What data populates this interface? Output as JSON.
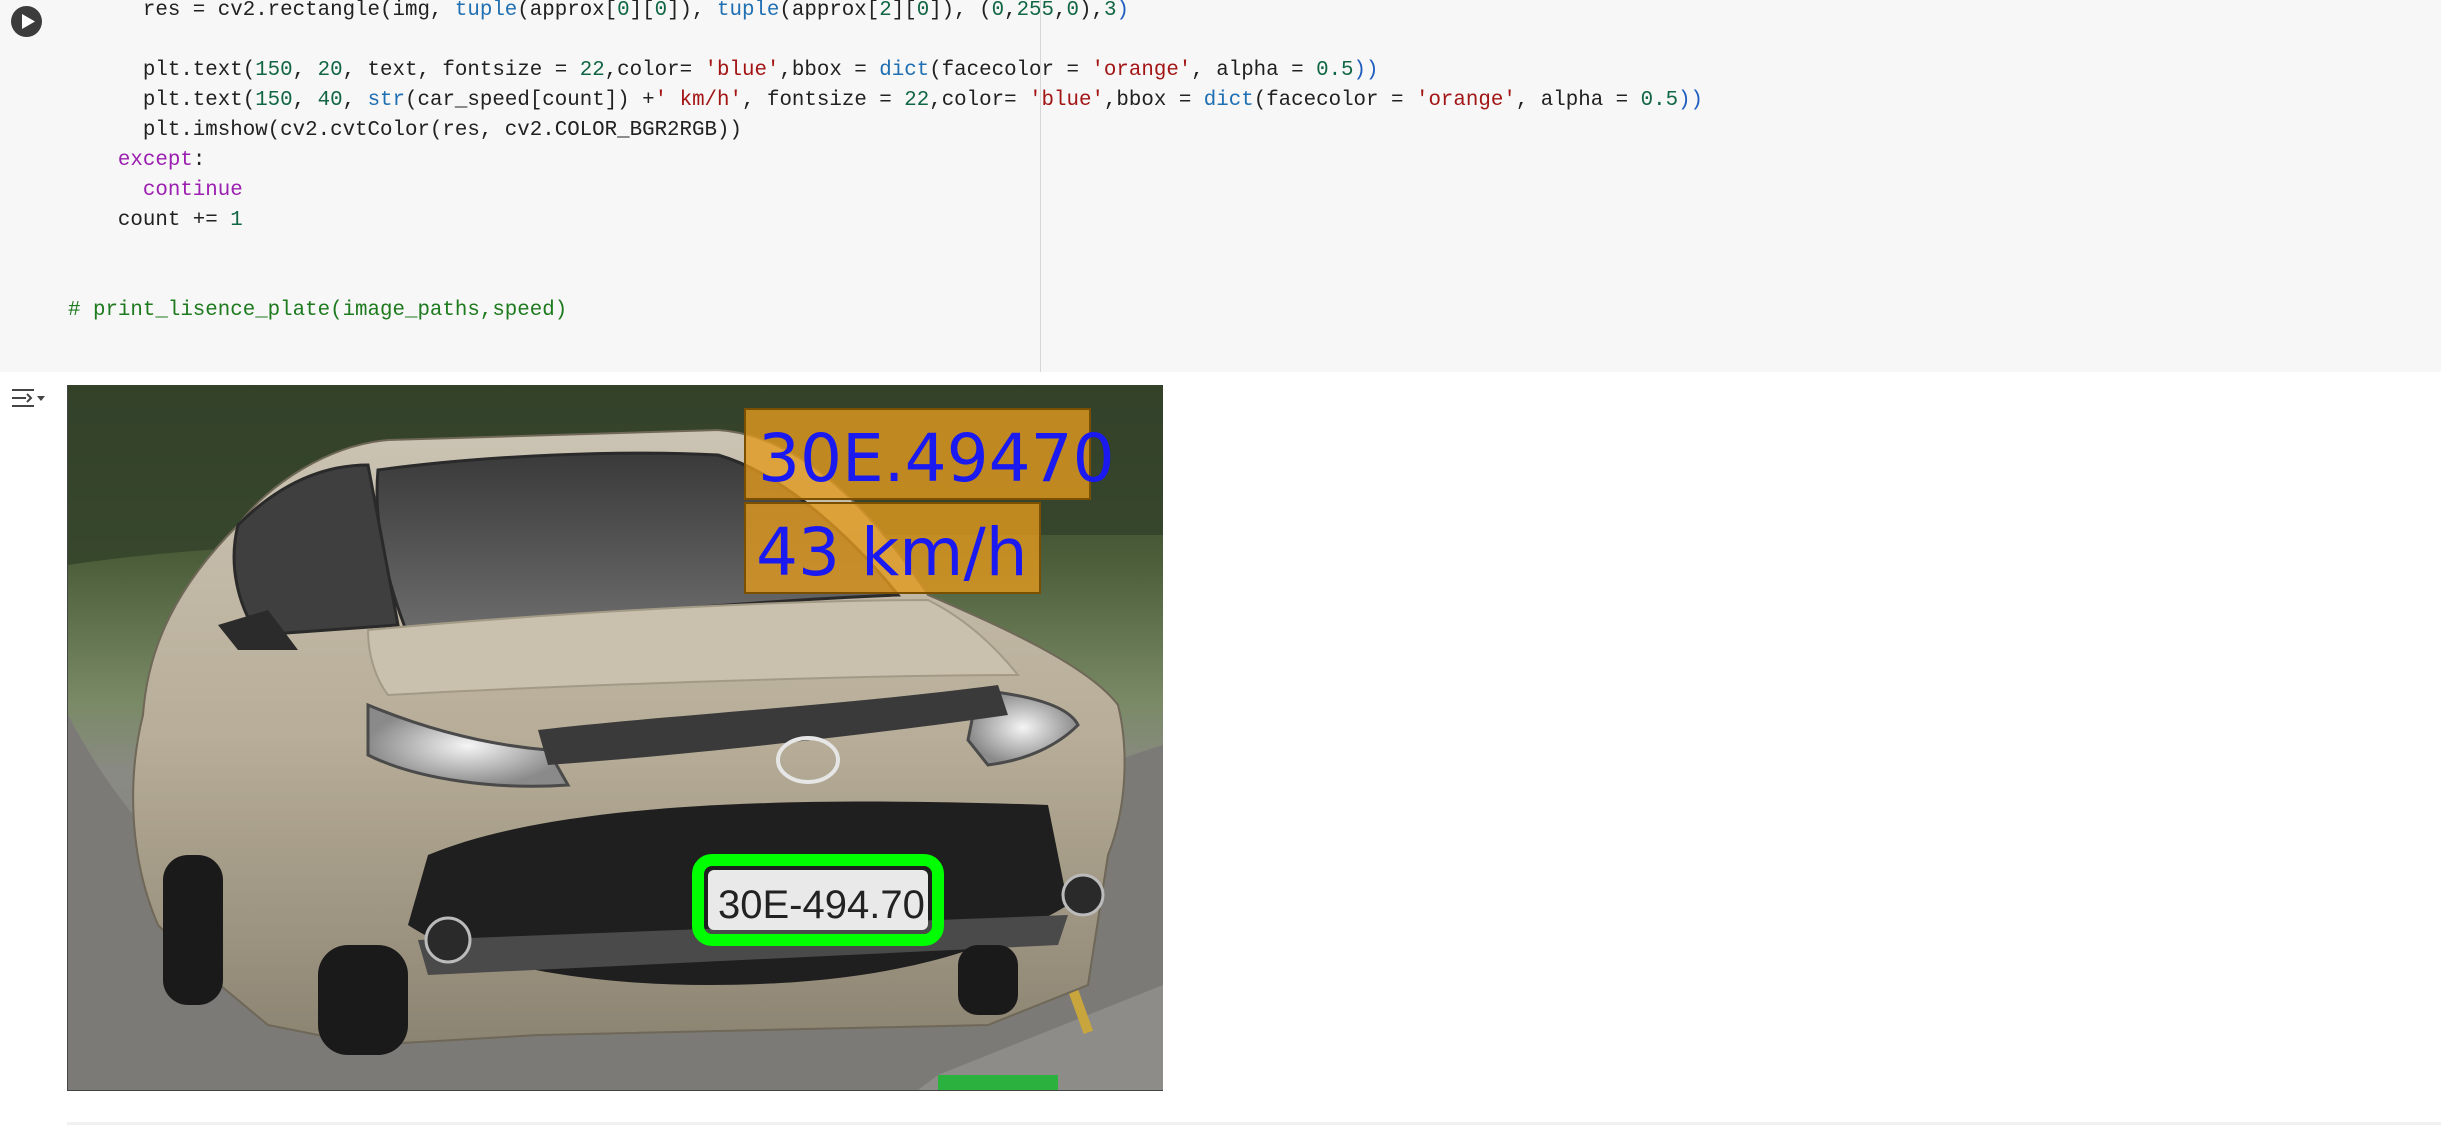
{
  "cell": {
    "run_button_label": "Run cell",
    "code_lines": [
      [
        {
          "t": "      res = cv2.rectangle(img, "
        },
        {
          "t": "tuple",
          "c": "fn"
        },
        {
          "t": "(approx["
        },
        {
          "t": "0",
          "c": "num"
        },
        {
          "t": "]["
        },
        {
          "t": "0",
          "c": "num"
        },
        {
          "t": "]), "
        },
        {
          "t": "tuple",
          "c": "fn"
        },
        {
          "t": "(approx["
        },
        {
          "t": "2",
          "c": "num"
        },
        {
          "t": "]["
        },
        {
          "t": "0",
          "c": "num"
        },
        {
          "t": "]), ("
        },
        {
          "t": "0",
          "c": "num"
        },
        {
          "t": ","
        },
        {
          "t": "255",
          "c": "num"
        },
        {
          "t": ","
        },
        {
          "t": "0",
          "c": "num"
        },
        {
          "t": "),"
        },
        {
          "t": "3",
          "c": "num"
        },
        {
          "t": ")",
          "c": "pn"
        }
      ],
      [
        {
          "t": ""
        }
      ],
      [
        {
          "t": "      plt.text("
        },
        {
          "t": "150",
          "c": "num"
        },
        {
          "t": ", "
        },
        {
          "t": "20",
          "c": "num"
        },
        {
          "t": ", text, fontsize = "
        },
        {
          "t": "22",
          "c": "num"
        },
        {
          "t": ",color= "
        },
        {
          "t": "'blue'",
          "c": "str"
        },
        {
          "t": ",bbox = "
        },
        {
          "t": "dict",
          "c": "fn"
        },
        {
          "t": "(facecolor = "
        },
        {
          "t": "'orange'",
          "c": "str"
        },
        {
          "t": ", alpha = "
        },
        {
          "t": "0.5",
          "c": "num"
        },
        {
          "t": "))",
          "c": "pn"
        }
      ],
      [
        {
          "t": "      plt.text("
        },
        {
          "t": "150",
          "c": "num"
        },
        {
          "t": ", "
        },
        {
          "t": "40",
          "c": "num"
        },
        {
          "t": ", "
        },
        {
          "t": "str",
          "c": "fn"
        },
        {
          "t": "(car_speed[count]) +"
        },
        {
          "t": "' km/h'",
          "c": "str"
        },
        {
          "t": ", fontsize = "
        },
        {
          "t": "22",
          "c": "num"
        },
        {
          "t": ",color= "
        },
        {
          "t": "'blue'",
          "c": "str"
        },
        {
          "t": ",bbox = "
        },
        {
          "t": "dict",
          "c": "fn"
        },
        {
          "t": "(facecolor = "
        },
        {
          "t": "'orange'",
          "c": "str"
        },
        {
          "t": ", alpha = "
        },
        {
          "t": "0.5",
          "c": "num"
        },
        {
          "t": "))",
          "c": "pn"
        }
      ],
      [
        {
          "t": "      plt.imshow(cv2.cvtColor(res, cv2.COLOR_BGR2RGB))"
        }
      ],
      [
        {
          "t": "    "
        },
        {
          "t": "except",
          "c": "kw"
        },
        {
          "t": ":"
        }
      ],
      [
        {
          "t": "      "
        },
        {
          "t": "continue",
          "c": "kw"
        }
      ],
      [
        {
          "t": "    count += "
        },
        {
          "t": "1",
          "c": "num"
        }
      ],
      [
        {
          "t": ""
        }
      ],
      [
        {
          "t": ""
        }
      ],
      [
        {
          "t": "# print_lisence_plate(image_paths,speed)",
          "c": "cm"
        }
      ]
    ]
  },
  "output": {
    "toggle_label": "Output actions",
    "figure": {
      "plate_text": "30E.49470",
      "speed_text": "43 km/h",
      "plate_on_car": "30E-494.70",
      "annotation_text_color": "#1a1af0",
      "annotation_box_color": "#f0a020",
      "rectangle_color": "#00ff00"
    }
  },
  "colors": {
    "cell_background": "#f7f7f7",
    "function": "#1f6fb2",
    "string": "#a31515",
    "number": "#116644",
    "keyword": "#9b1fb0",
    "comment": "#1e7a1e"
  }
}
